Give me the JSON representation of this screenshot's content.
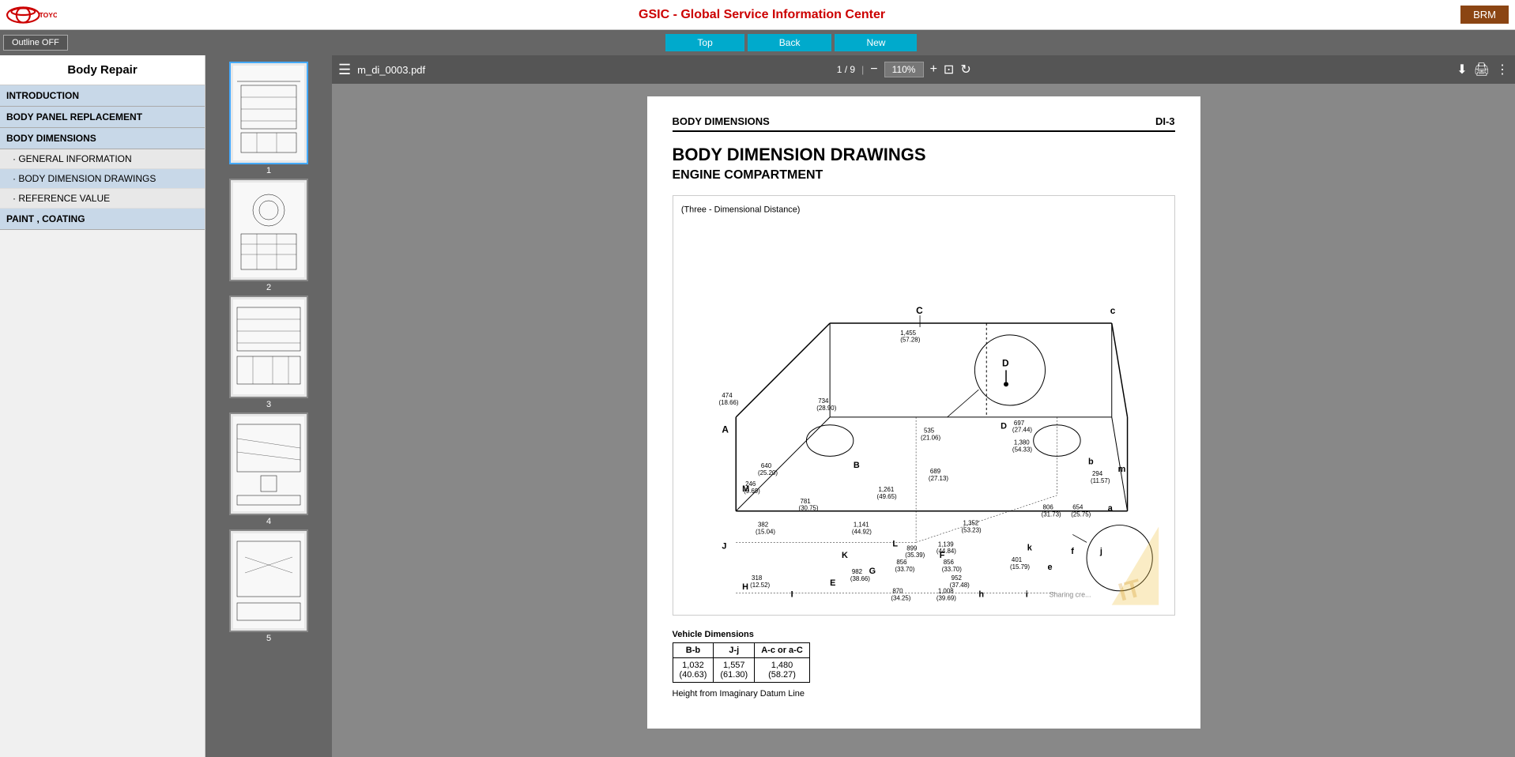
{
  "app": {
    "title": "GSIC - Global Service Information Center",
    "brm_label": "BRM"
  },
  "navbar": {
    "outline_off": "Outline OFF",
    "top": "Top",
    "back": "Back",
    "new": "New"
  },
  "sidebar": {
    "title": "Body Repair",
    "sections": [
      {
        "id": "introduction",
        "label": "INTRODUCTION",
        "type": "section"
      },
      {
        "id": "body-panel",
        "label": "BODY PANEL REPLACEMENT",
        "type": "section"
      },
      {
        "id": "body-dimensions",
        "label": "BODY DIMENSIONS",
        "type": "section",
        "active": true
      },
      {
        "id": "general-info",
        "label": "· GENERAL INFORMATION",
        "type": "item"
      },
      {
        "id": "body-dim-drawings",
        "label": "· BODY DIMENSION DRAWINGS",
        "type": "item",
        "active": true
      },
      {
        "id": "reference-value",
        "label": "· REFERENCE VALUE",
        "type": "item"
      },
      {
        "id": "paint-coating",
        "label": "PAINT , COATING",
        "type": "section"
      }
    ]
  },
  "pdf": {
    "filename": "m_di_0003.pdf",
    "page_current": "1",
    "page_total": "9",
    "zoom": "110%"
  },
  "page_content": {
    "header_left": "BODY DIMENSIONS",
    "header_right": "DI-3",
    "title": "BODY DIMENSION DRAWINGS",
    "subtitle": "ENGINE COMPARTMENT",
    "drawing_label": "(Three - Dimensional Distance)",
    "vehicle_dim_label": "Vehicle Dimensions",
    "height_label": "Height from Imaginary Datum Line",
    "table_headers": [
      "B-b",
      "J-j",
      "A-c or a-C"
    ],
    "table_row1": [
      "1,032\n(40.63)",
      "1,557\n(61.30)",
      "1,480\n(58.27)"
    ]
  },
  "thumbnails": [
    {
      "num": "1",
      "selected": true
    },
    {
      "num": "2",
      "selected": false
    },
    {
      "num": "3",
      "selected": false
    },
    {
      "num": "4",
      "selected": false
    },
    {
      "num": "5",
      "selected": false
    }
  ],
  "icons": {
    "menu": "☰",
    "zoom_out": "−",
    "zoom_in": "+",
    "fit_page": "⊡",
    "rotate": "↻",
    "download": "⬇",
    "print": "🖨",
    "more": "⋮"
  }
}
